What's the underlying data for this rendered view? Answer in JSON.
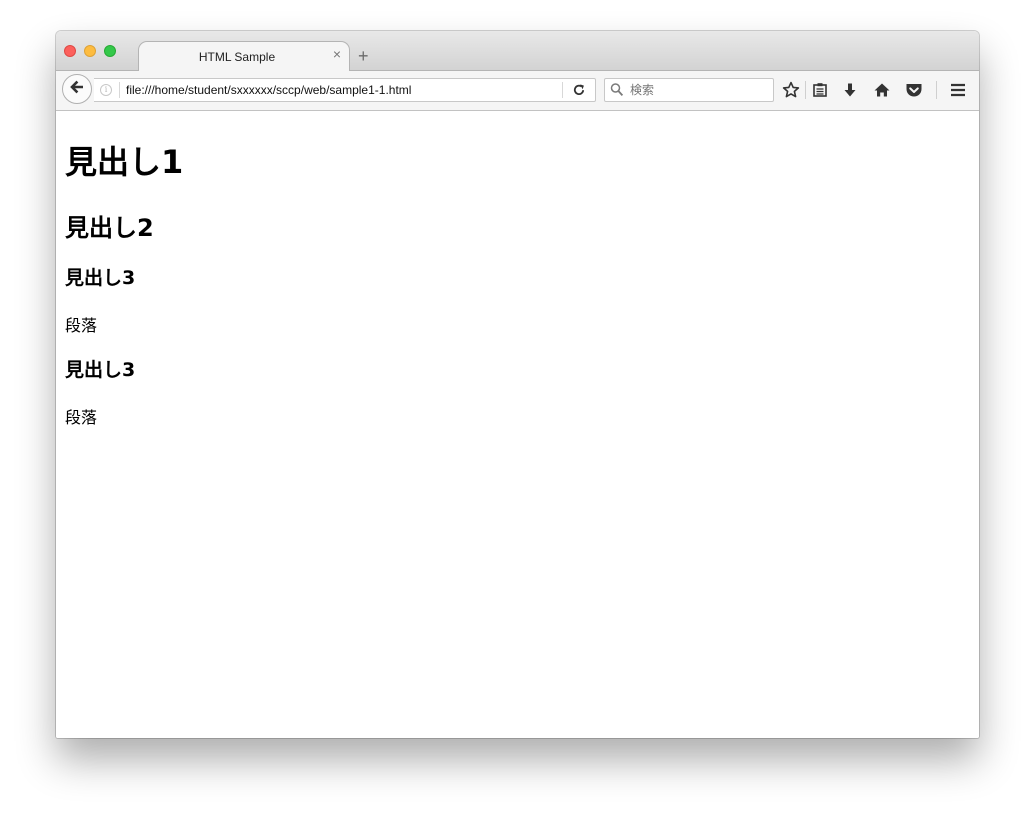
{
  "browser": {
    "tab": {
      "title": "HTML Sample",
      "close_glyph": "×"
    },
    "new_tab_glyph": "+",
    "url": "file:///home/student/sxxxxxx/sccp/web/sample1-1.html",
    "search_placeholder": "検索",
    "toolbar_icons": [
      "back-arrow-icon",
      "info-icon",
      "reload-icon",
      "search-icon",
      "bookmark-star-icon",
      "reading-list-icon",
      "download-icon",
      "home-icon",
      "pocket-icon",
      "menu-icon"
    ],
    "colors": {
      "close": "#fc605c",
      "minimize": "#fdbc40",
      "maximize": "#34c84a"
    }
  },
  "page": {
    "h1": "見出し1",
    "h2": "見出し2",
    "sections": [
      {
        "heading": "見出し3",
        "paragraph": "段落"
      },
      {
        "heading": "見出し3",
        "paragraph": "段落"
      }
    ]
  }
}
